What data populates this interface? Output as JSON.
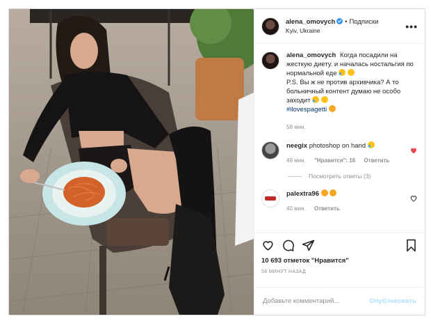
{
  "post": {
    "author": "alena_omovych",
    "follow_label": "Подписки",
    "location": "Kyiv, Ukraine",
    "more_label": "•••"
  },
  "caption": {
    "author": "alena_omovych",
    "line1": "Когда посадили на жесткую диету. и началась ностальгия по нормальной еде",
    "line2": "P.S. Вы ж не против архивчика? А то больничный контент думаю не особо заходит",
    "hashtag": "#ilovespagetti",
    "age": "58 мин."
  },
  "comments": [
    {
      "author": "neegix",
      "text": "photoshop on hand",
      "age": "49 мин.",
      "likes": "\"Нравится\": 16",
      "reply": "Ответить",
      "liked": true
    },
    {
      "author": "palextra96",
      "text": "",
      "age": "40 мин.",
      "reply": "Ответить",
      "liked": false
    }
  ],
  "view_replies": "Посмотреть ответы (3)",
  "actions": {
    "likes_count": "10 693 отметок \"Нравится\"",
    "timestamp": "58 минут назад"
  },
  "add_comment": {
    "placeholder": "Добавьте комментарий...",
    "publish_label": "Опубликовать"
  },
  "colors": {
    "verified": "#3897f0",
    "heart_liked": "#ed4956",
    "link": "#00376b",
    "publish_disabled": "#b2dffc"
  },
  "icons": [
    "heart-icon",
    "comment-icon",
    "share-icon",
    "bookmark-icon",
    "verified-icon",
    "more-icon"
  ]
}
